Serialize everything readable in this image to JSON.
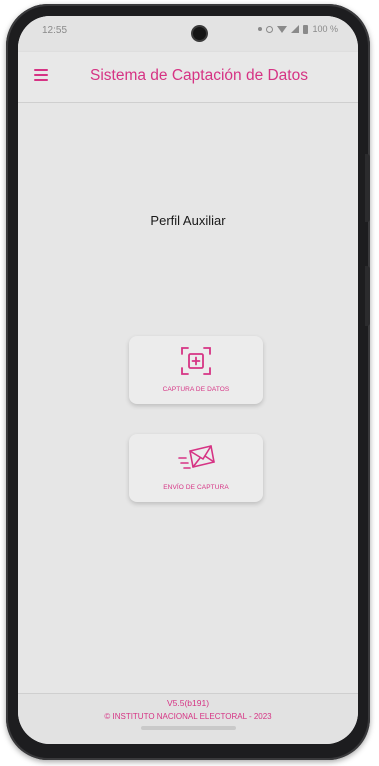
{
  "status": {
    "time": "12:55",
    "battery": "100 %",
    "icons": [
      "notification-dot-icon",
      "ring-icon",
      "wifi-icon",
      "signal-icon",
      "battery-icon"
    ]
  },
  "appbar": {
    "title": "Sistema de Captación de Datos",
    "menu_icon": "hamburger-menu-icon"
  },
  "main": {
    "profile": "Perfil Auxiliar",
    "actions": [
      {
        "label": "CAPTURA DE DATOS",
        "icon": "capture-scan-icon"
      },
      {
        "label": "ENVÍO DE CAPTURA",
        "icon": "send-envelope-icon"
      }
    ]
  },
  "footer": {
    "version": "V5.5(b191)",
    "copyright": "© INSTITUTO NACIONAL ELECTORAL - 2023"
  },
  "colors": {
    "accent": "#d63384",
    "background": "#e6e6e6"
  }
}
